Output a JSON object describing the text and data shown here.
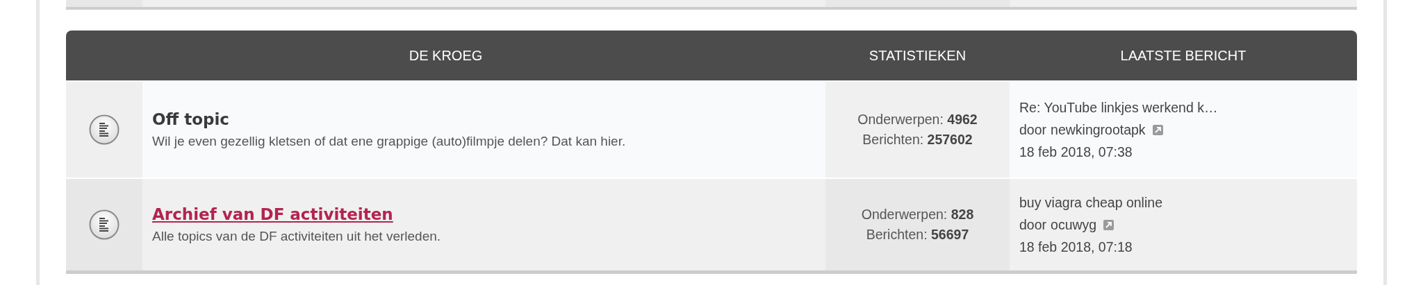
{
  "section": {
    "columns": [
      "DE KROEG",
      "STATISTIEKEN",
      "LAATSTE BERICHT"
    ],
    "forums": [
      {
        "title": "Off topic",
        "highlighted": false,
        "description": "Wil je even gezellig kletsen of dat ene grappige (auto)filmpje delen? Dat kan hier.",
        "topics_label": "Onderwerpen:",
        "topics": "4962",
        "posts_label": "Berichten:",
        "posts": "257602",
        "last_post": {
          "subject": "Re: YouTube linkjes werkend k…",
          "by": "door",
          "author": "newkingrootapk",
          "date": "18 feb 2018, 07:38"
        }
      },
      {
        "title": "Archief van DF activiteiten",
        "highlighted": true,
        "description": "Alle topics van de DF activiteiten uit het verleden.",
        "topics_label": "Onderwerpen:",
        "topics": "828",
        "posts_label": "Berichten:",
        "posts": "56697",
        "last_post": {
          "subject": "buy viagra cheap online",
          "by": "door",
          "author": "ocuwyg",
          "date": "18 feb 2018, 07:18"
        }
      }
    ]
  }
}
